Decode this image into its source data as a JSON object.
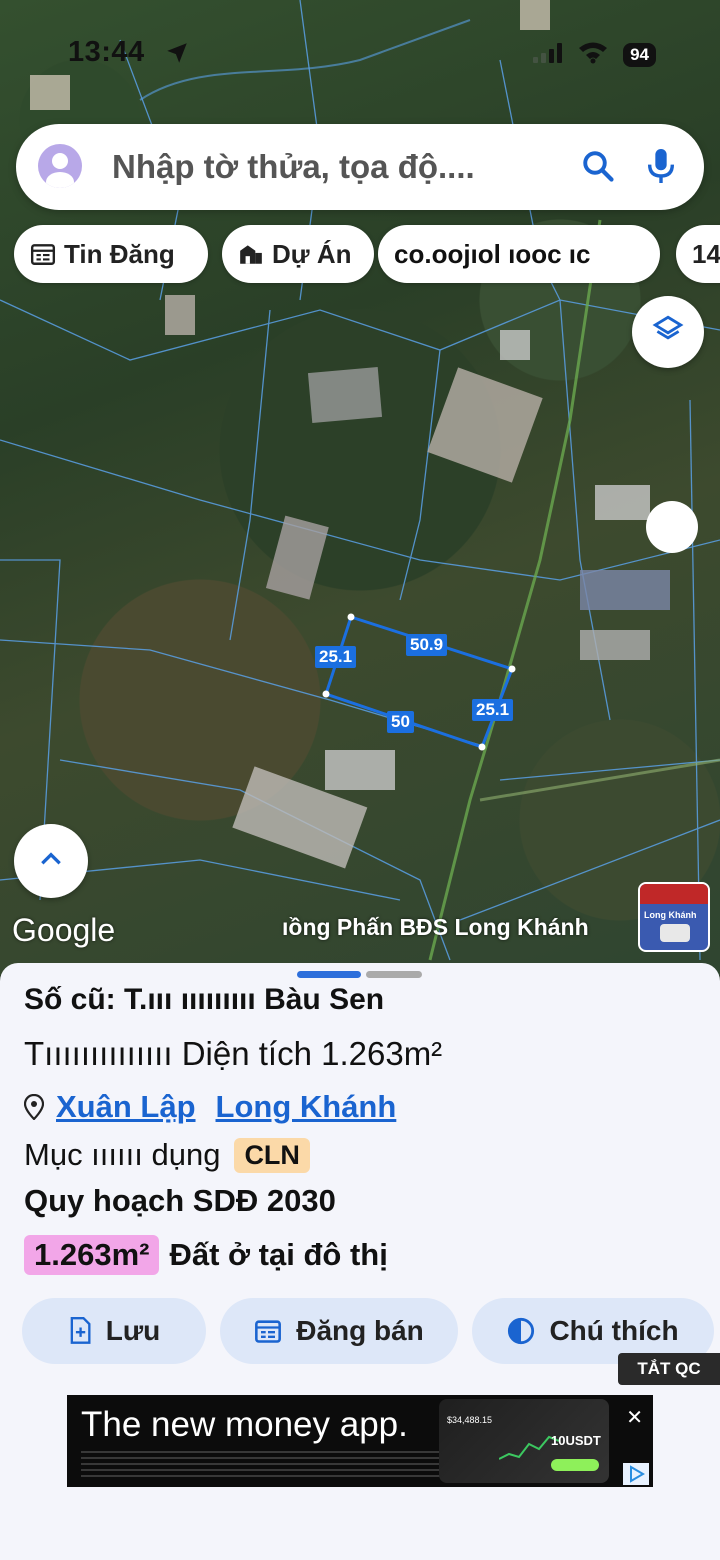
{
  "status_bar": {
    "time": "13:44",
    "battery": "94"
  },
  "search": {
    "placeholder": "Nhập tờ thửa, tọa độ...."
  },
  "chips": [
    {
      "label": "Tin Đăng",
      "icon": "calendar-icon"
    },
    {
      "label": "Dự Án",
      "icon": "building-icon"
    },
    {
      "label": "co.oojıol ıooc ıc"
    },
    {
      "label": "14"
    }
  ],
  "map": {
    "dimensions": [
      "25.1",
      "50.9",
      "50",
      "25.1"
    ],
    "provider": "Google",
    "watermark": "ıồng Phấn BĐS Long Khánh",
    "thumbnail_text": "Long Khánh"
  },
  "parcel": {
    "old_number_label": "Số cũ:",
    "old_number_value": "T.ııı ııııııııı",
    "location": "Bàu Sen",
    "row2_obscured": "Tıııııııııııııı",
    "area_label": "Diện tích",
    "area_value": "1.263m²",
    "ward": "Xuân Lập",
    "city": "Long Khánh",
    "usage_label": "Mục ıııııı dụng",
    "usage_code": "CLN",
    "plan_label": "Quy hoạch SDĐ 2030",
    "plan_area": "1.263m²",
    "plan_type": "Đất ở tại đô thị"
  },
  "actions": [
    {
      "label": "Lưu",
      "icon": "document-add-icon"
    },
    {
      "label": "Đăng bán",
      "icon": "calendar-icon"
    },
    {
      "label": "Chú thích",
      "icon": "contrast-icon"
    }
  ],
  "ad": {
    "hide_label": "TẮT QC",
    "headline": "The new money app.",
    "price_small": "$34,488.15",
    "ticker": "10USDT"
  },
  "colors": {
    "accent": "#1a64d0",
    "parcel_outline": "#1b6fe0",
    "cln_tag": "#fbd9a8",
    "area_tag": "#f2a6e8"
  }
}
